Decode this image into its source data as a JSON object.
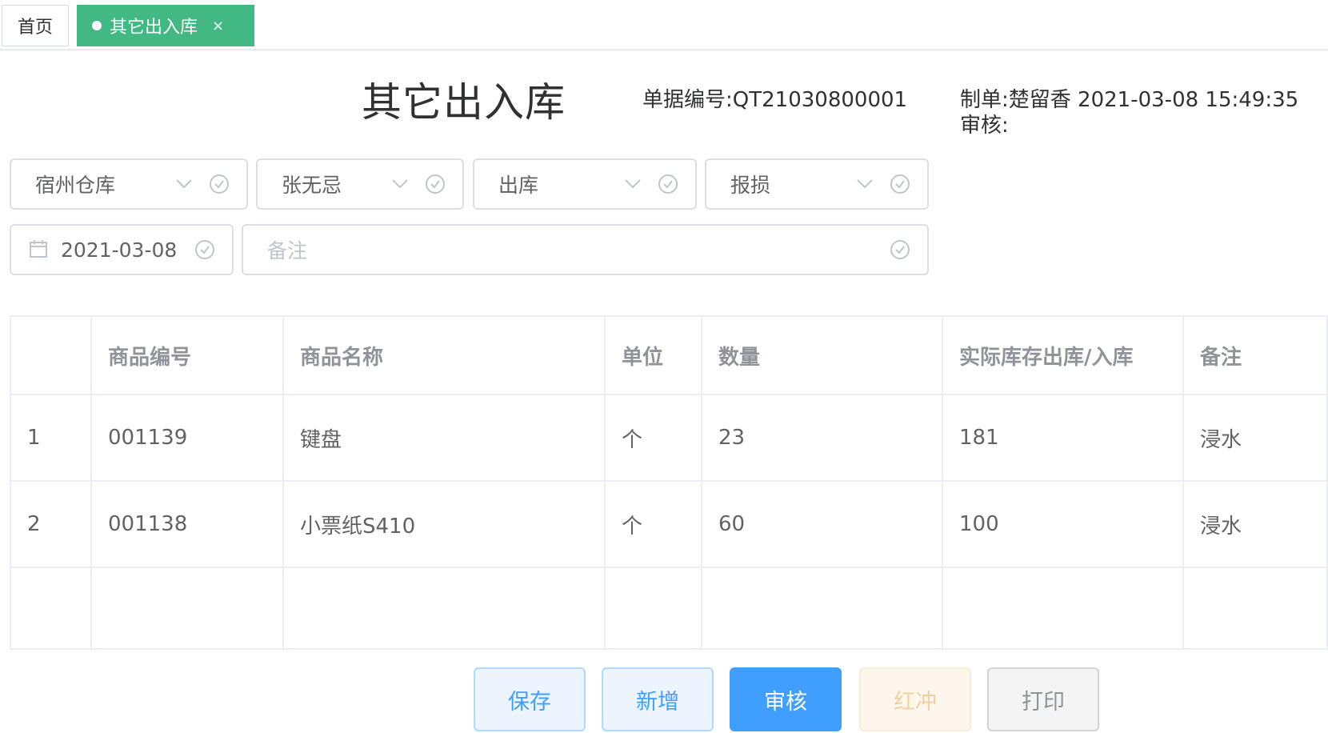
{
  "tabs": {
    "home_label": "首页",
    "active_label": "其它出入库",
    "close_symbol": "×"
  },
  "header": {
    "title": "其它出入库",
    "doc_no_label": "单据编号:",
    "doc_no": "QT21030800001",
    "maker_label": "制单:",
    "maker": "楚留香",
    "made_at": "2021-03-08 15:49:35",
    "auditor_label": "审核:"
  },
  "form": {
    "warehouse": "宿州仓库",
    "handler": "张无忌",
    "direction": "出库",
    "reason": "报损",
    "date": "2021-03-08",
    "remark_placeholder": "备注",
    "icons": {
      "dropdown": "chevron-down-icon",
      "status": "check-circle-icon",
      "date": "calendar-icon"
    }
  },
  "table": {
    "columns": [
      "",
      "商品编号",
      "商品名称",
      "单位",
      "数量",
      "实际库存出库/入库",
      "备注"
    ],
    "rows": [
      [
        "1",
        "001139",
        "键盘",
        "个",
        "23",
        "181",
        "浸水"
      ],
      [
        "2",
        "001138",
        "小票纸S410",
        "个",
        "60",
        "100",
        "浸水"
      ]
    ]
  },
  "actions": {
    "save": "保存",
    "add": "新增",
    "audit": "审核",
    "red_reverse": "红冲",
    "print": "打印"
  },
  "colors": {
    "active_tab": "#42b983",
    "primary": "#409eff",
    "border": "#dcdfe6"
  }
}
